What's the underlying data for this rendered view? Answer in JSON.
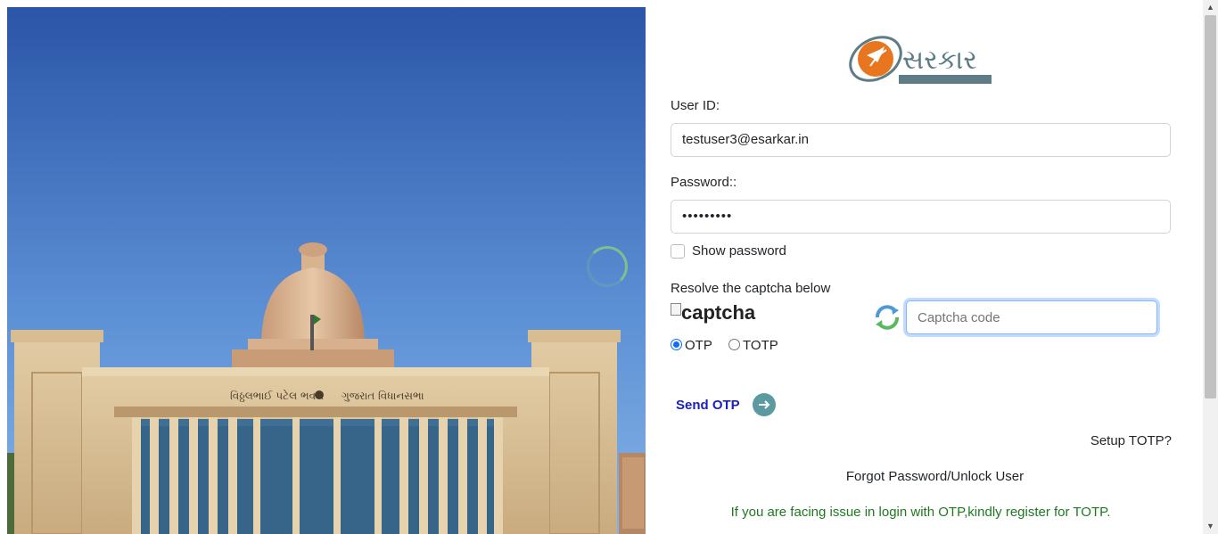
{
  "logo": {
    "text": "સરકાર"
  },
  "form": {
    "user_id_label": "User ID:",
    "user_id_value": "testuser3@esarkar.in",
    "password_label": "Password::",
    "password_value": "•••••••••",
    "show_password_label": "Show password",
    "captcha_prompt": "Resolve the captcha below",
    "captcha_alt": "captcha",
    "captcha_placeholder": "Captcha code",
    "otp_label": "OTP",
    "totp_label": "TOTP",
    "selected_method": "OTP",
    "send_otp_label": "Send OTP"
  },
  "links": {
    "setup_totp": "Setup TOTP?",
    "forgot_password": "Forgot Password/Unlock User"
  },
  "notice": "If you are facing issue in login with OTP,kindly register for TOTP.",
  "hero": {
    "building_sign_left": "વિઠ્ઠલભાઈ પટેલ ભવન",
    "building_sign_right": "ગુજરાત વિધાનસભા"
  },
  "colors": {
    "link_blue": "#1a20c2",
    "notice_green": "#1e7a1e",
    "logo_orange": "#e8761f",
    "logo_gray": "#5e7c86"
  }
}
